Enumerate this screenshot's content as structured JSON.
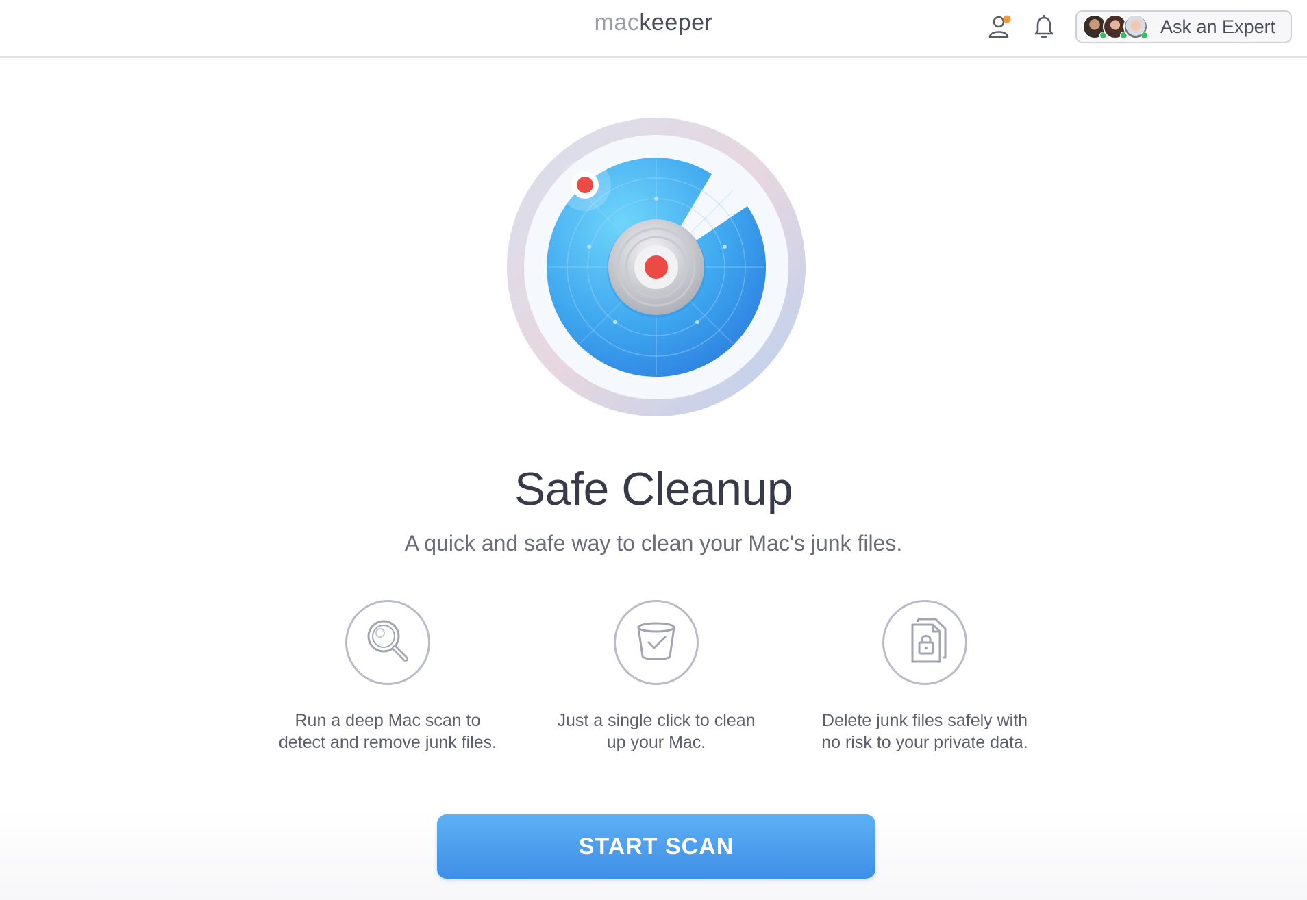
{
  "header": {
    "logo_mac": "mac",
    "logo_keeper": "keeper",
    "account_icon": "user-account-icon",
    "notifications_icon": "bell-icon",
    "expert_button_label": "Ask an Expert"
  },
  "main": {
    "title": "Safe Cleanup",
    "subtitle": "A quick and safe way to clean your Mac's junk files.",
    "features": [
      {
        "icon": "magnifier-icon",
        "text_line1": "Run a deep Mac scan to",
        "text_line2": "detect and remove junk files."
      },
      {
        "icon": "trash-check-icon",
        "text_line1": "Just a single click to clean",
        "text_line2": "up your Mac."
      },
      {
        "icon": "locked-file-icon",
        "text_line1": "Delete junk files safely with",
        "text_line2": "no risk to your private data."
      }
    ],
    "start_button_label": "START SCAN"
  },
  "colors": {
    "accent": "#4a9cf0",
    "notification_dot": "#f59a3c",
    "radar_red": "#ec4b45",
    "online": "#36c25c"
  }
}
